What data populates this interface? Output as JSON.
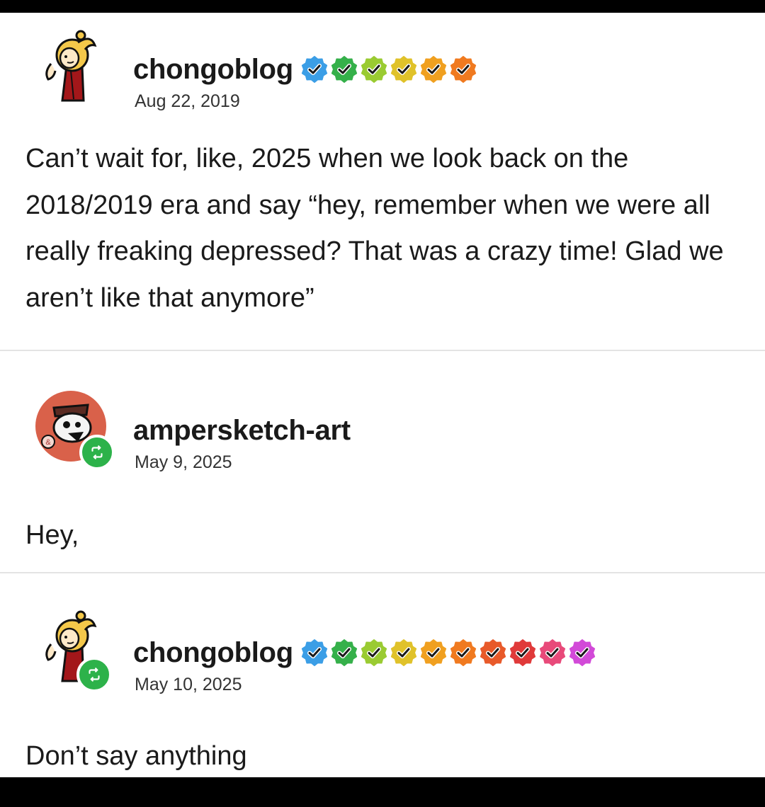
{
  "posts": [
    {
      "username": "chongoblog",
      "date": "Aug 22, 2019",
      "reblog": false,
      "badge_colors": [
        "#3b9ee6",
        "#35b04a",
        "#9acb32",
        "#e0c22a",
        "#f0a020",
        "#f07a20"
      ],
      "text": "Can’t wait for, like, 2025 when we look back on the 2018/2019 era and say “hey, remember when we were all really freaking depressed? That was a crazy time! Glad we aren’t like that anymore”"
    },
    {
      "username": "ampersketch-art",
      "date": "May 9, 2025",
      "reblog": true,
      "badge_colors": [],
      "text": "Hey,"
    },
    {
      "username": "chongoblog",
      "date": "May 10, 2025",
      "reblog": true,
      "badge_colors": [
        "#3b9ee6",
        "#35b04a",
        "#9acb32",
        "#e0c22a",
        "#f0a020",
        "#f07a20",
        "#e85a2a",
        "#e03a3a",
        "#e84a7a",
        "#d24ad8"
      ],
      "text": "Don’t say anything"
    }
  ],
  "icons": {
    "verified_badge": "check-badge-icon",
    "reblog": "reblog-icon",
    "avatar_chongoblog": "cartoon-character-avatar",
    "avatar_ampersketch": "skull-character-avatar"
  }
}
